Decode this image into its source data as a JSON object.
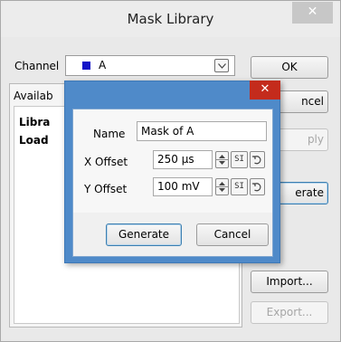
{
  "window": {
    "title": "Mask Library",
    "close_glyph": "✕"
  },
  "channel": {
    "label": "Channel",
    "value": "A",
    "swatch_color": "#1414c8"
  },
  "library": {
    "tab_label": "Availab",
    "line1": "Libra",
    "line2": "Load"
  },
  "buttons": {
    "ok": "OK",
    "cancel": "ncel",
    "apply": "ply",
    "generate": "erate",
    "import": "Import...",
    "export": "Export..."
  },
  "generate_dialog": {
    "close_glyph": "✕",
    "name_label": "Name",
    "name_value": "Mask of A",
    "x_offset_label": "X Offset",
    "x_offset_value": "250 µs",
    "y_offset_label": "Y Offset",
    "y_offset_value": "100 mV",
    "si_label": "SI",
    "generate_label": "Generate",
    "cancel_label": "Cancel"
  },
  "colors": {
    "dialog_accent": "#4f8ac9",
    "close_red": "#c42b1c"
  }
}
